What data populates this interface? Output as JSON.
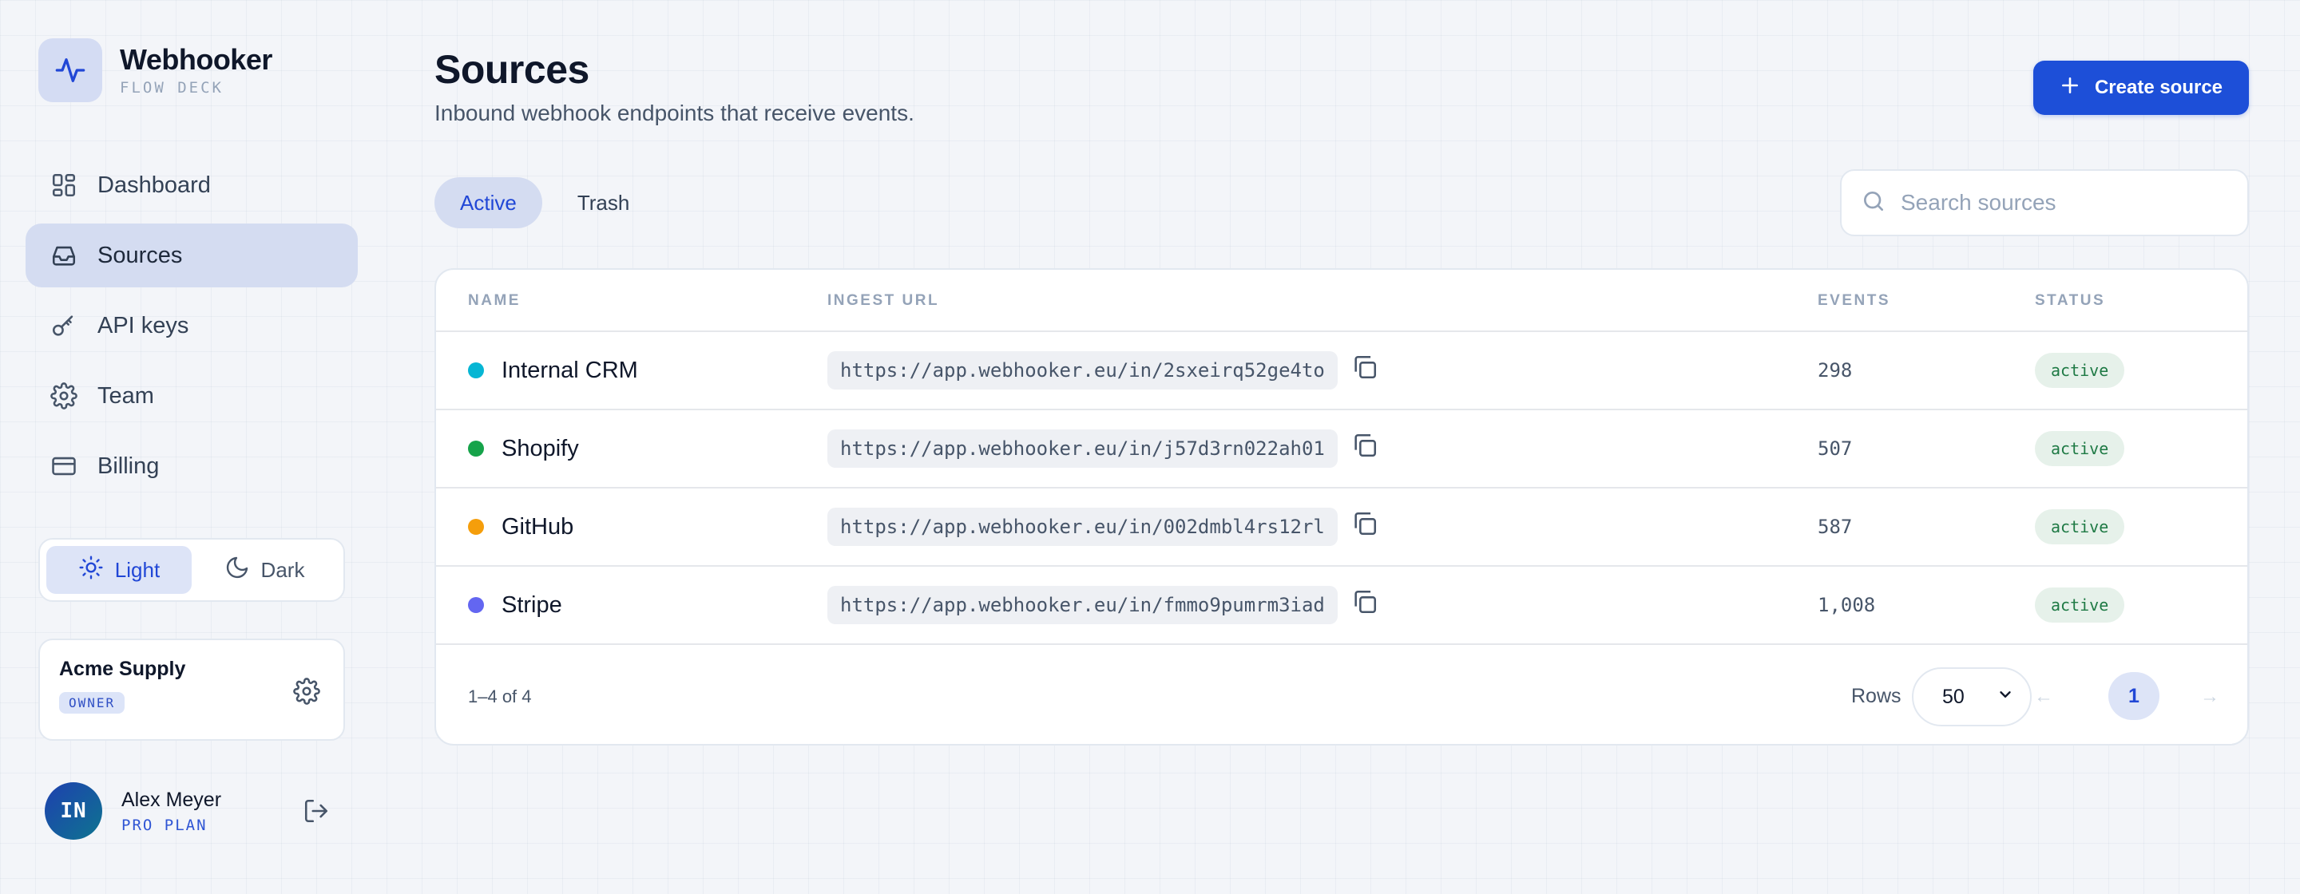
{
  "brand": {
    "name": "Webhooker",
    "subtitle": "FLOW DECK",
    "logo_icon": "activity-pulse-icon"
  },
  "sidebar": {
    "items": [
      {
        "label": "Dashboard",
        "icon": "dashboard-grid-icon",
        "active": false
      },
      {
        "label": "Sources",
        "icon": "inbox-icon",
        "active": true
      },
      {
        "label": "API keys",
        "icon": "key-icon",
        "active": false
      },
      {
        "label": "Team",
        "icon": "gear-icon",
        "active": false
      },
      {
        "label": "Billing",
        "icon": "credit-card-icon",
        "active": false
      }
    ],
    "theme": {
      "light_label": "Light",
      "dark_label": "Dark",
      "selected": "light"
    },
    "org": {
      "name": "Acme Supply",
      "role": "OWNER"
    },
    "user": {
      "initials": "IN",
      "name": "Alex Meyer",
      "plan": "PRO PLAN"
    }
  },
  "header": {
    "title": "Sources",
    "subtitle": "Inbound webhook endpoints that receive events.",
    "create_label": "Create source"
  },
  "tabs": [
    {
      "label": "Active",
      "active": true
    },
    {
      "label": "Trash",
      "active": false
    }
  ],
  "search": {
    "placeholder": "Search sources",
    "value": ""
  },
  "table": {
    "columns": {
      "name": "NAME",
      "url": "INGEST URL",
      "events": "EVENTS",
      "status": "STATUS"
    },
    "rows": [
      {
        "name": "Internal CRM",
        "color": "#06b6d4",
        "url": "https://app.webhooker.eu/in/2sxeirq52ge4to",
        "events": "298",
        "status": "active"
      },
      {
        "name": "Shopify",
        "color": "#16a34a",
        "url": "https://app.webhooker.eu/in/j57d3rn022ah01",
        "events": "507",
        "status": "active"
      },
      {
        "name": "GitHub",
        "color": "#f59e0b",
        "url": "https://app.webhooker.eu/in/002dmbl4rs12rl",
        "events": "587",
        "status": "active"
      },
      {
        "name": "Stripe",
        "color": "#6366f1",
        "url": "https://app.webhooker.eu/in/fmmo9pumrm3iad",
        "events": "1,008",
        "status": "active"
      }
    ]
  },
  "pagination": {
    "range_text": "1–4 of 4",
    "rows_label": "Rows",
    "rows_per_page": "50",
    "prev": "←",
    "current_page": "1",
    "next": "→"
  },
  "colors": {
    "accent": "#1d4fd8",
    "active_nav": "#d4dcf1",
    "status_bg": "#e6f1ea",
    "status_text": "#1f7a45"
  }
}
